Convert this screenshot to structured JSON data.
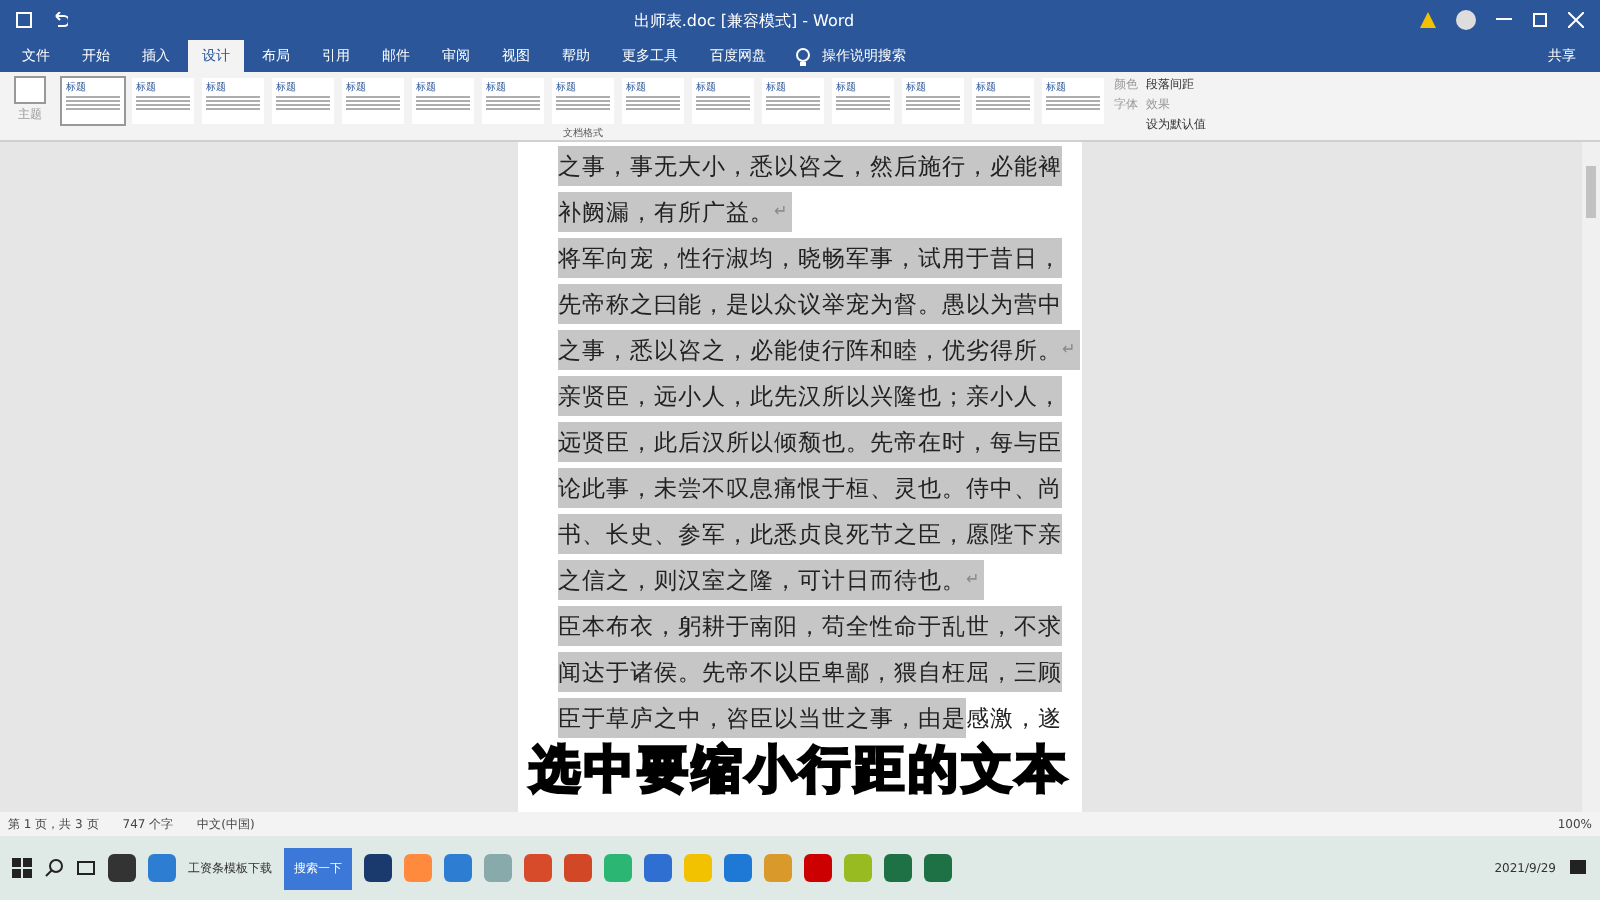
{
  "window": {
    "title": "出师表.doc [兼容模式] - Word"
  },
  "tabs": [
    {
      "label": "文件",
      "selected": false
    },
    {
      "label": "开始",
      "selected": false
    },
    {
      "label": "插入",
      "selected": false
    },
    {
      "label": "设计",
      "selected": true
    },
    {
      "label": "布局",
      "selected": false
    },
    {
      "label": "引用",
      "selected": false
    },
    {
      "label": "邮件",
      "selected": false
    },
    {
      "label": "审阅",
      "selected": false
    },
    {
      "label": "视图",
      "selected": false
    },
    {
      "label": "帮助",
      "selected": false
    },
    {
      "label": "更多工具",
      "selected": false
    },
    {
      "label": "百度网盘",
      "selected": false
    }
  ],
  "tell_me": "操作说明搜索",
  "share": "共享",
  "ribbon": {
    "theme_button": "主题",
    "gallery": [
      {
        "title": "标题",
        "selected": true
      },
      {
        "title": "标题",
        "selected": false
      },
      {
        "title": "标题",
        "selected": false
      },
      {
        "title": "标题",
        "selected": false
      },
      {
        "title": "标题",
        "selected": false
      },
      {
        "title": "标题",
        "selected": false
      },
      {
        "title": "标题",
        "selected": false
      },
      {
        "title": "标题",
        "selected": false
      },
      {
        "title": "标题",
        "selected": false
      },
      {
        "title": "标题",
        "selected": false
      },
      {
        "title": "标题",
        "selected": false
      },
      {
        "title": "标题",
        "selected": false
      },
      {
        "title": "标题",
        "selected": false
      },
      {
        "title": "标题",
        "selected": false
      },
      {
        "title": "标题",
        "selected": false
      }
    ],
    "group_label": "文档格式",
    "colors": "颜色",
    "fonts": "字体",
    "paragraph_spacing": "段落间距",
    "effects": "效果",
    "set_default": "设为默认值"
  },
  "document": {
    "lines": [
      {
        "parts": [
          {
            "text": "之事，事无大小，悉以咨之，然后施行，必能裨",
            "selected": true
          }
        ]
      },
      {
        "parts": [
          {
            "text": "补阙漏，有所广益。",
            "selected": true
          }
        ],
        "end_mark": "↵"
      },
      {
        "parts": [
          {
            "text": "将军向宠，性行淑均，晓畅军事，试用于昔日，",
            "selected": true
          }
        ]
      },
      {
        "parts": [
          {
            "text": "先帝称之曰能，是以众议举宠为督。愚以为营中",
            "selected": true
          }
        ]
      },
      {
        "parts": [
          {
            "text": "之事，悉以咨之，必能使行阵和睦，优劣得所。",
            "selected": true
          }
        ],
        "end_mark": "↵"
      },
      {
        "parts": [
          {
            "text": "亲贤臣，远小人，此先汉所以兴隆也；亲小人，",
            "selected": true
          }
        ]
      },
      {
        "parts": [
          {
            "text": "远贤臣，此后汉所以倾颓也。先帝在时，每与臣",
            "selected": true
          }
        ]
      },
      {
        "parts": [
          {
            "text": "论此事，未尝不叹息痛恨于桓、灵也。侍中、尚",
            "selected": true
          }
        ]
      },
      {
        "parts": [
          {
            "text": "书、长史、参军，此悉贞良死节之臣，愿陛下亲",
            "selected": true
          }
        ]
      },
      {
        "parts": [
          {
            "text": "之信之，则汉室之隆，可计日而待也。",
            "selected": true
          }
        ],
        "end_mark": "↵"
      },
      {
        "parts": [
          {
            "text": "臣本布衣，躬耕于南阳，苟全性命于乱世，不求",
            "selected": true
          }
        ]
      },
      {
        "parts": [
          {
            "text": "闻达于诸侯。先帝不以臣卑鄙，猥自枉屈，三顾",
            "selected": true
          }
        ]
      },
      {
        "parts": [
          {
            "text": "臣于草庐之中，咨臣以当世之事，由是",
            "selected": true
          },
          {
            "text": "感激，遂",
            "selected": false
          }
        ]
      }
    ]
  },
  "subtitle": "选中要缩小行距的文本",
  "status_bar": {
    "page": "第 1 页，共 3 页",
    "words": "747 个字",
    "language": "中文(中国)",
    "zoom": "100%"
  },
  "taskbar": {
    "browser_task": "工资条模板下载",
    "search_button": "搜索一下",
    "date": "2021/9/29"
  }
}
